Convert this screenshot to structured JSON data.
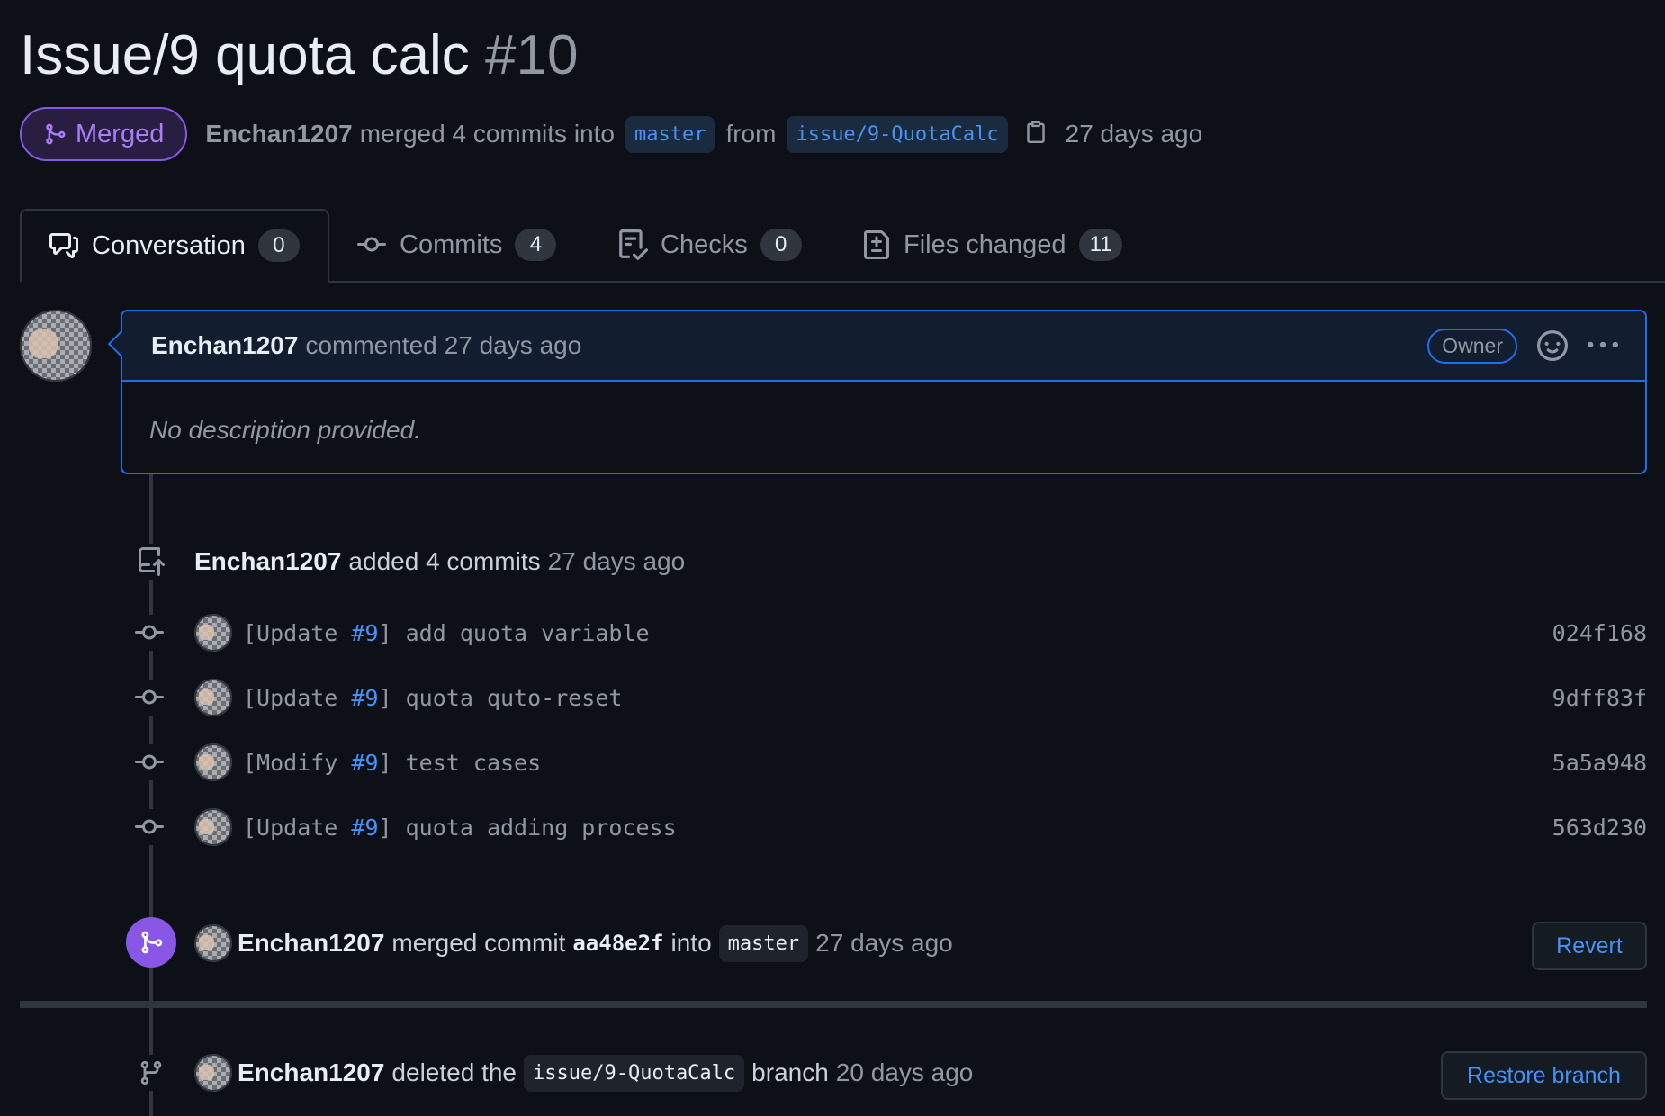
{
  "pr": {
    "title": "Issue/9 quota calc",
    "number": "#10",
    "state": "Merged",
    "author": "Enchan1207",
    "merge_text": "merged 4 commits into",
    "base_branch": "master",
    "from_text": "from",
    "head_branch": "issue/9-QuotaCalc",
    "time": "27 days ago"
  },
  "tabs": [
    {
      "label": "Conversation",
      "count": "0",
      "icon": "comment-discussion-icon"
    },
    {
      "label": "Commits",
      "count": "4",
      "icon": "git-commit-icon"
    },
    {
      "label": "Checks",
      "count": "0",
      "icon": "checklist-icon"
    },
    {
      "label": "Files changed",
      "count": "11",
      "icon": "file-diff-icon"
    }
  ],
  "comment": {
    "author": "Enchan1207",
    "action": "commented",
    "time": "27 days ago",
    "badge": "Owner",
    "body": "No description provided."
  },
  "commits_event": {
    "author": "Enchan1207",
    "action": "added 4 commits",
    "time": "27 days ago"
  },
  "commits": [
    {
      "prefix": "[Update ",
      "ref": "#9",
      "suffix": "] add quota variable",
      "sha": "024f168"
    },
    {
      "prefix": "[Update ",
      "ref": "#9",
      "suffix": "] quota quto-reset",
      "sha": "9dff83f"
    },
    {
      "prefix": "[Modify ",
      "ref": "#9",
      "suffix": "] test cases",
      "sha": "5a5a948"
    },
    {
      "prefix": "[Update ",
      "ref": "#9",
      "suffix": "] quota adding process",
      "sha": "563d230"
    }
  ],
  "merge_event": {
    "author": "Enchan1207",
    "action": "merged commit",
    "sha": "aa48e2f",
    "into": "into",
    "branch": "master",
    "time": "27 days ago",
    "button": "Revert"
  },
  "delete_event": {
    "author": "Enchan1207",
    "action": "deleted the",
    "branch": "issue/9-QuotaCalc",
    "suffix": "branch",
    "time": "20 days ago",
    "button": "Restore branch"
  },
  "colors": {
    "background": "#0d1117",
    "merged_purple": "#8957e5",
    "link_blue": "#4493f8",
    "border": "#30363d"
  }
}
